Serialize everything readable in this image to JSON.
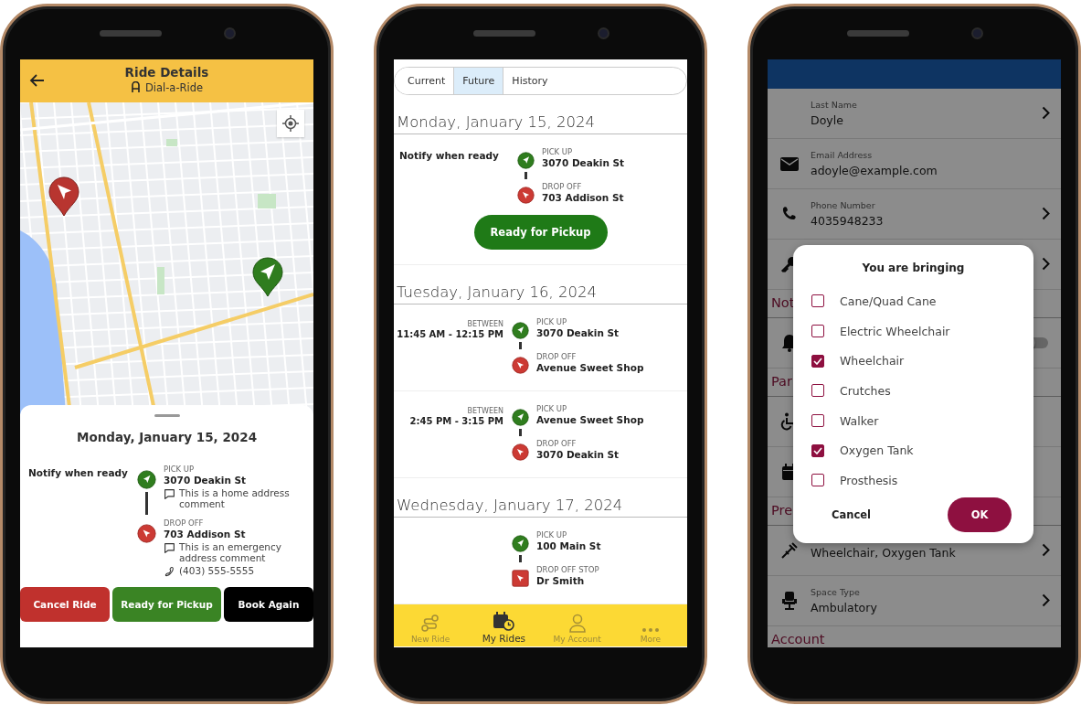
{
  "ride_details": {
    "title": "Ride Details",
    "subtitle": "Dial-a-Ride",
    "date": "Monday, January 15, 2024",
    "notify": "Notify when ready",
    "stops": [
      {
        "kind": "pickup",
        "label": "PICK UP",
        "address": "3070 Deakin St",
        "comment": "This is a home address comment"
      },
      {
        "kind": "dropoff",
        "label": "DROP OFF",
        "address": "703 Addison St",
        "comment": "This is an emergency address comment",
        "phone": "(403) 555-5555"
      }
    ],
    "buttons": [
      {
        "kind": "danger",
        "label": "Cancel Ride"
      },
      {
        "kind": "success",
        "label": "Ready for Pickup"
      },
      {
        "kind": "dark",
        "label": "Book Again"
      }
    ]
  },
  "my_rides": {
    "tabs": [
      {
        "label": "Current",
        "selected": false
      },
      {
        "label": "Future",
        "selected": true
      },
      {
        "label": "History",
        "selected": false
      }
    ],
    "days": [
      {
        "date": "Monday, January 15, 2024",
        "rides": [
          {
            "notify": "Notify when ready",
            "stops": [
              {
                "kind": "pickup",
                "label": "PICK UP",
                "address": "3070 Deakin St"
              },
              {
                "kind": "dropoff",
                "label": "DROP OFF",
                "address": "703 Addison St"
              }
            ],
            "action": "Ready for Pickup"
          }
        ]
      },
      {
        "date": "Tuesday, January 16, 2024",
        "rides": [
          {
            "between": "BETWEEN",
            "time": "11:45 AM - 12:15 PM",
            "stops": [
              {
                "kind": "pickup",
                "label": "PICK UP",
                "address": "3070 Deakin St"
              },
              {
                "kind": "dropoff",
                "label": "DROP OFF",
                "address": "Avenue Sweet Shop"
              }
            ]
          },
          {
            "between": "BETWEEN",
            "time": "2:45 PM - 3:15 PM",
            "stops": [
              {
                "kind": "pickup",
                "label": "PICK UP",
                "address": "Avenue Sweet Shop"
              },
              {
                "kind": "dropoff",
                "label": "DROP OFF",
                "address": "3070 Deakin St"
              }
            ]
          }
        ]
      },
      {
        "date": "Wednesday, January 17, 2024",
        "rides": [
          {
            "stops": [
              {
                "kind": "pickup",
                "label": "PICK UP",
                "address": "100 Main St"
              },
              {
                "kind": "stop",
                "label": "DROP OFF STOP",
                "address": "Dr Smith"
              }
            ]
          }
        ]
      }
    ],
    "nav": [
      {
        "kind": "new_ride",
        "label": "New Ride",
        "selected": false
      },
      {
        "kind": "rides",
        "label": "My Rides",
        "selected": true
      },
      {
        "kind": "account",
        "label": "My Account",
        "selected": false
      },
      {
        "kind": "more",
        "label": "More",
        "selected": false
      }
    ]
  },
  "profile": {
    "rows": [
      {
        "kind": "name",
        "label": "Last Name",
        "value": "Doyle",
        "chevron": true
      },
      {
        "kind": "email",
        "label": "Email Address",
        "value": "adoyle@example.com",
        "chevron": false
      },
      {
        "kind": "phone",
        "label": "Phone Number",
        "value": "4035948233",
        "chevron": true
      },
      {
        "kind": "password",
        "chevron": true
      },
      {
        "kind": "section",
        "title": "Not"
      },
      {
        "kind": "notifications",
        "on": false
      },
      {
        "kind": "section",
        "title": "Par"
      },
      {
        "kind": "accessibility"
      },
      {
        "kind": "schedule"
      },
      {
        "kind": "section",
        "title": "Pre"
      },
      {
        "kind": "mobility_aids",
        "value": "Wheelchair, Oxygen Tank",
        "chevron": true
      },
      {
        "kind": "space",
        "label": "Space Type",
        "value": "Ambulatory",
        "chevron": true
      },
      {
        "kind": "section",
        "title": "Account"
      }
    ],
    "dialog": {
      "title": "You are bringing",
      "options": [
        {
          "label": "Cane/Quad Cane",
          "checked": false
        },
        {
          "label": "Electric Wheelchair",
          "checked": false
        },
        {
          "label": "Wheelchair",
          "checked": true
        },
        {
          "label": "Crutches",
          "checked": false
        },
        {
          "label": "Walker",
          "checked": false
        },
        {
          "label": "Oxygen Tank",
          "checked": true
        },
        {
          "label": "Prosthesis",
          "checked": false
        }
      ],
      "cancel": "Cancel",
      "ok": "OK"
    }
  }
}
